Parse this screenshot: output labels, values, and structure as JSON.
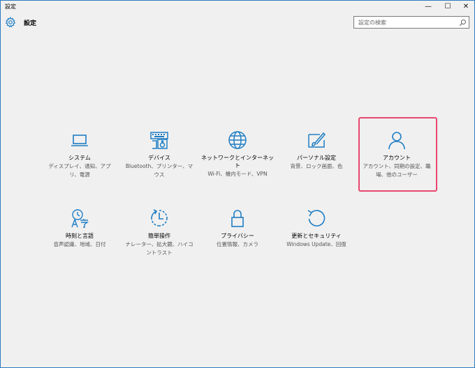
{
  "window": {
    "title": "設定",
    "min_glyph": "—",
    "max_glyph": "☐",
    "close_glyph": "✕"
  },
  "header": {
    "title": "設定",
    "search_placeholder": "設定の検索",
    "icon": "gear-icon"
  },
  "accent_color": "#1f7ec4",
  "highlight_color": "#e8476e",
  "tiles": [
    {
      "label": "システム",
      "sub": "ディスプレイ、通知、アプリ、電源",
      "icon": "laptop-icon"
    },
    {
      "label": "デバイス",
      "sub": "Bluetooth、プリンター、マウス",
      "icon": "keyboard-speaker-icon"
    },
    {
      "label": "ネットワークとインターネット",
      "sub": "Wi-Fi、機内モード、VPN",
      "icon": "globe-icon"
    },
    {
      "label": "パーソナル設定",
      "sub": "背景、ロック画面、色",
      "icon": "paint-brush-icon"
    },
    {
      "label": "アカウント",
      "sub": "アカウント、同期の設定、職場、他のユーザー",
      "icon": "person-icon"
    },
    {
      "label": "時刻と言語",
      "sub": "音声認識、地域、日付",
      "icon": "time-language-icon"
    },
    {
      "label": "簡単操作",
      "sub": "ナレーター、拡大鏡、ハイコントラスト",
      "icon": "ease-of-access-icon"
    },
    {
      "label": "プライバシー",
      "sub": "位置情報、カメラ",
      "icon": "lock-icon"
    },
    {
      "label": "更新とセキュリティ",
      "sub": "Windows Update、回復",
      "icon": "refresh-icon"
    }
  ]
}
